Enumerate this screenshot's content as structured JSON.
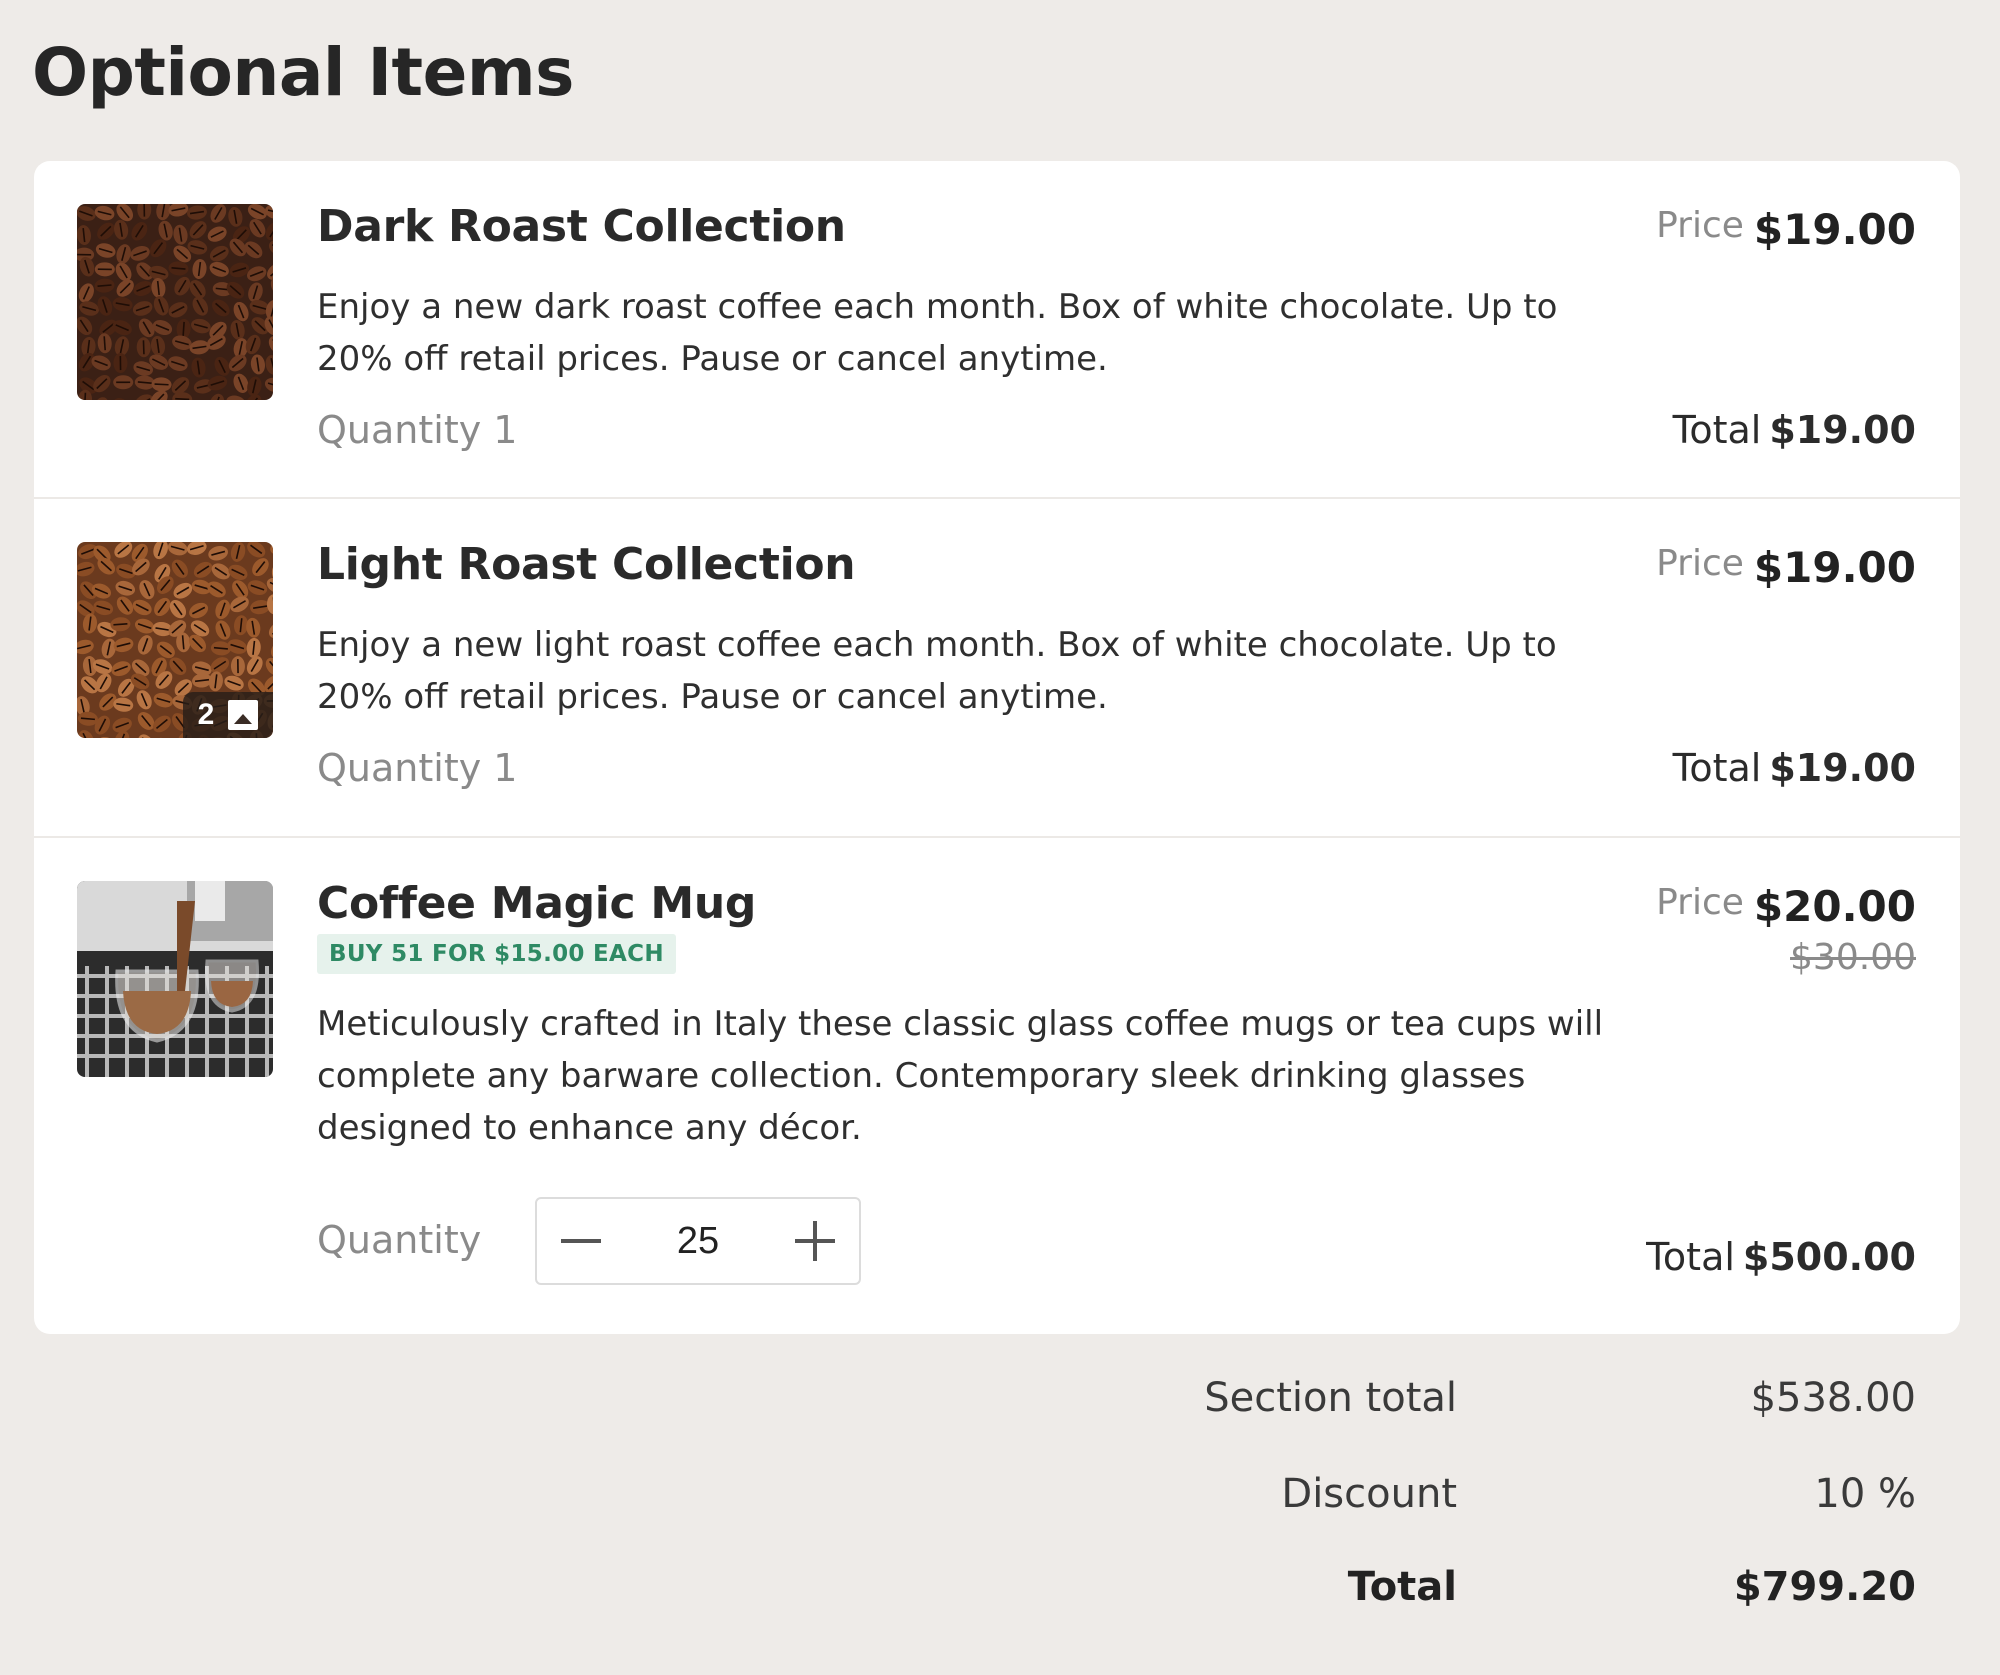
{
  "page": {
    "title": "Optional Items"
  },
  "items": [
    {
      "name": "Dark Roast Collection",
      "description": "Enjoy a new dark roast coffee each month. Box of white chocolate. Up to 20% off retail prices. Pause or cancel anytime.",
      "price_label": "Price",
      "price": "$19.00",
      "quantity_label": "Quantity 1",
      "total_label": "Total",
      "total": "$19.00",
      "image": "dark-roast-beans"
    },
    {
      "name": "Light Roast Collection",
      "description": "Enjoy a new light roast coffee each month. Box of white chocolate. Up to 20% off retail prices. Pause or cancel anytime.",
      "price_label": "Price",
      "price": "$19.00",
      "quantity_label": "Quantity 1",
      "total_label": "Total",
      "total": "$19.00",
      "image": "light-roast-beans",
      "image_count": "2"
    },
    {
      "name": "Coffee Magic Mug",
      "badge": "BUY 51 FOR $15.00 EACH",
      "description": "Meticulously crafted in Italy these classic glass coffee mugs or tea cups will complete any barware collection. Contemporary sleek drinking glasses designed to enhance any décor.",
      "price_label": "Price",
      "price": "$20.00",
      "old_price": "$30.00",
      "quantity_label": "Quantity",
      "quantity": "25",
      "total_label": "Total",
      "total": "$500.00",
      "image": "espresso-glass-mugs"
    }
  ],
  "summary": {
    "section_total_label": "Section total",
    "section_total": "$538.00",
    "discount_label": "Discount",
    "discount": "10 %",
    "total_label": "Total",
    "total": "$799.20"
  },
  "colors": {
    "background": "#eeebe8",
    "card": "#ffffff",
    "badge_bg": "#e6f2ec",
    "badge_text": "#2e8a64"
  }
}
